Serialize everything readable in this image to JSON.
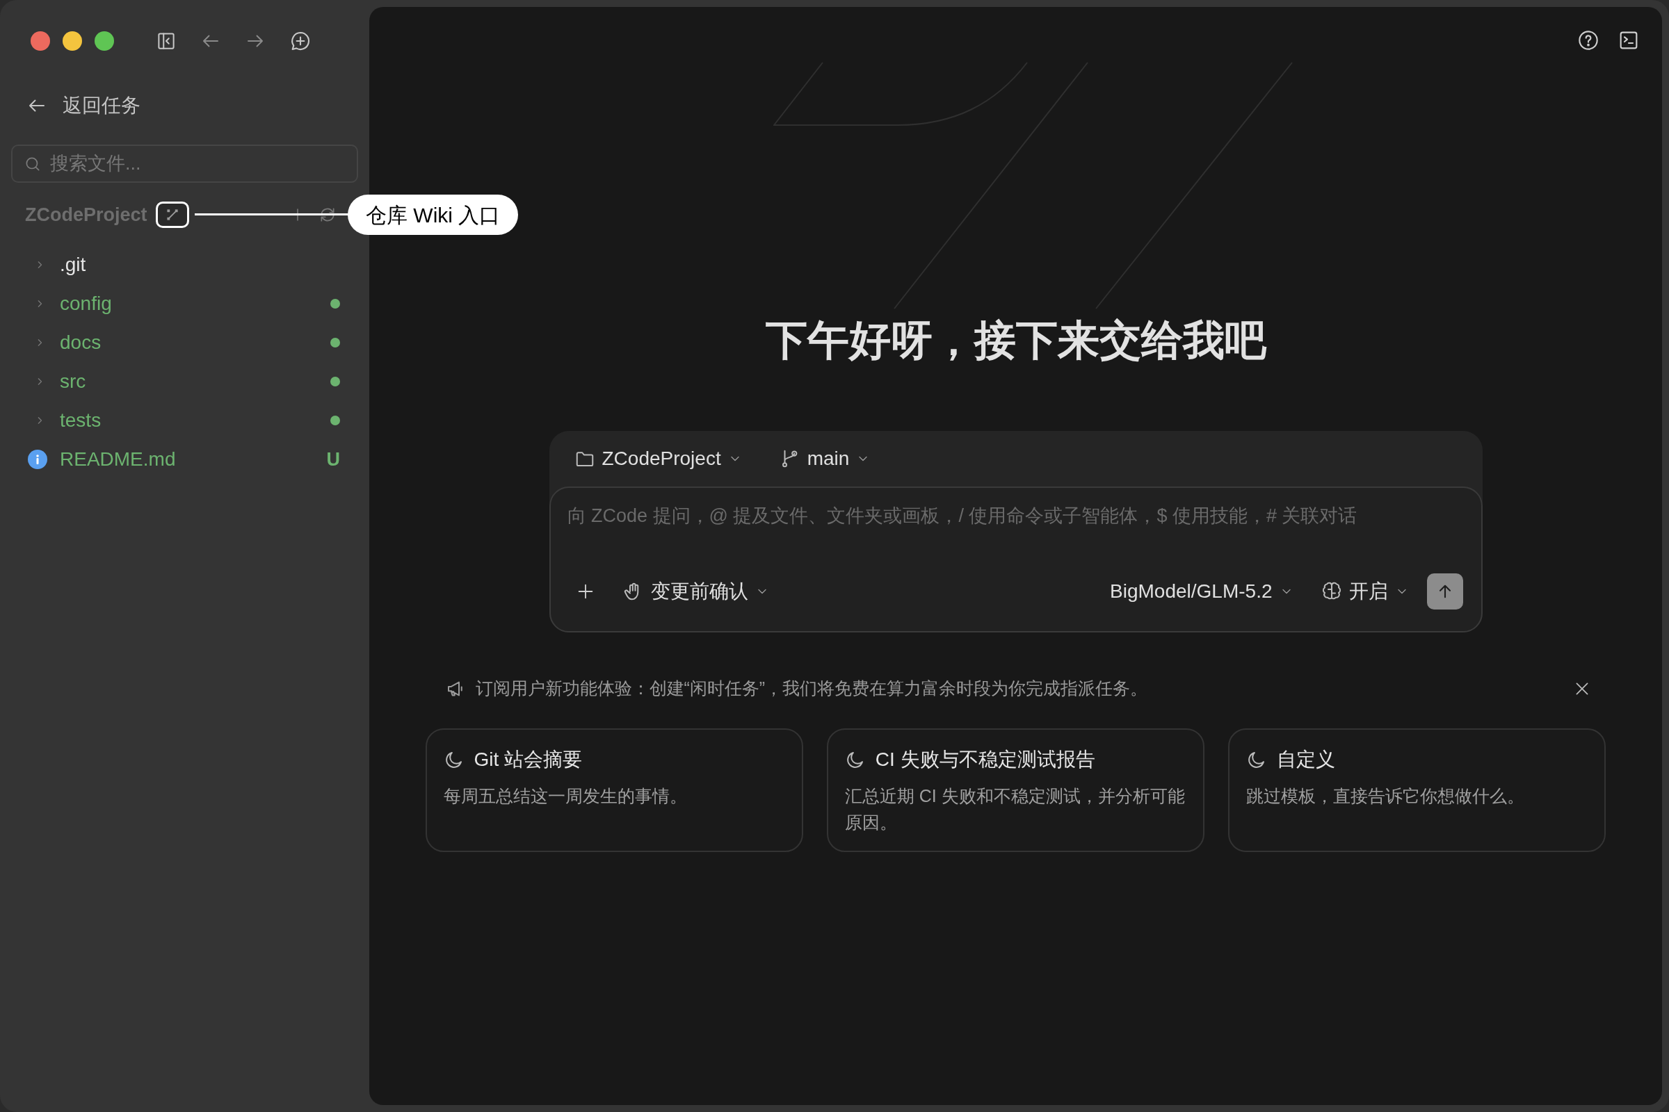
{
  "sidebar": {
    "back_label": "返回任务",
    "search": {
      "placeholder": "搜索文件..."
    },
    "project": {
      "name": "ZCodeProject"
    },
    "files": [
      {
        "name": ".git",
        "kind": "folder",
        "changed": false
      },
      {
        "name": "config",
        "kind": "folder",
        "changed": true,
        "color": "#6cb36f"
      },
      {
        "name": "docs",
        "kind": "folder",
        "changed": true,
        "color": "#6cb36f"
      },
      {
        "name": "src",
        "kind": "folder",
        "changed": true,
        "color": "#6cb36f"
      },
      {
        "name": "tests",
        "kind": "folder",
        "changed": true,
        "color": "#6cb36f"
      },
      {
        "name": "README.md",
        "kind": "file",
        "changed": false,
        "badge": "U",
        "color": "#6cb36f"
      }
    ]
  },
  "annotation": {
    "label": "仓库 Wiki 入口"
  },
  "main": {
    "greeting": "下午好呀，接下来交给我吧",
    "composer": {
      "folder": "ZCodeProject",
      "branch": "main",
      "placeholder": "向 ZCode 提问，@ 提及文件、文件夹或画板，/ 使用命令或子智能体，$ 使用技能，# 关联对话",
      "mode": "变更前确认",
      "model": "BigModel/GLM-5.2",
      "thinking": "开启"
    },
    "notice": {
      "text": "订阅用户新功能体验：创建“闲时任务”，我们将免费在算力富余时段为你完成指派任务。"
    },
    "templates": [
      {
        "title": "Git 站会摘要",
        "description": "每周五总结这一周发生的事情。"
      },
      {
        "title": "CI 失败与不稳定测试报告",
        "description": "汇总近期 CI 失败和不稳定测试，并分析可能原因。"
      },
      {
        "title": "自定义",
        "description": "跳过模板，直接告诉它你想做什么。"
      }
    ]
  }
}
